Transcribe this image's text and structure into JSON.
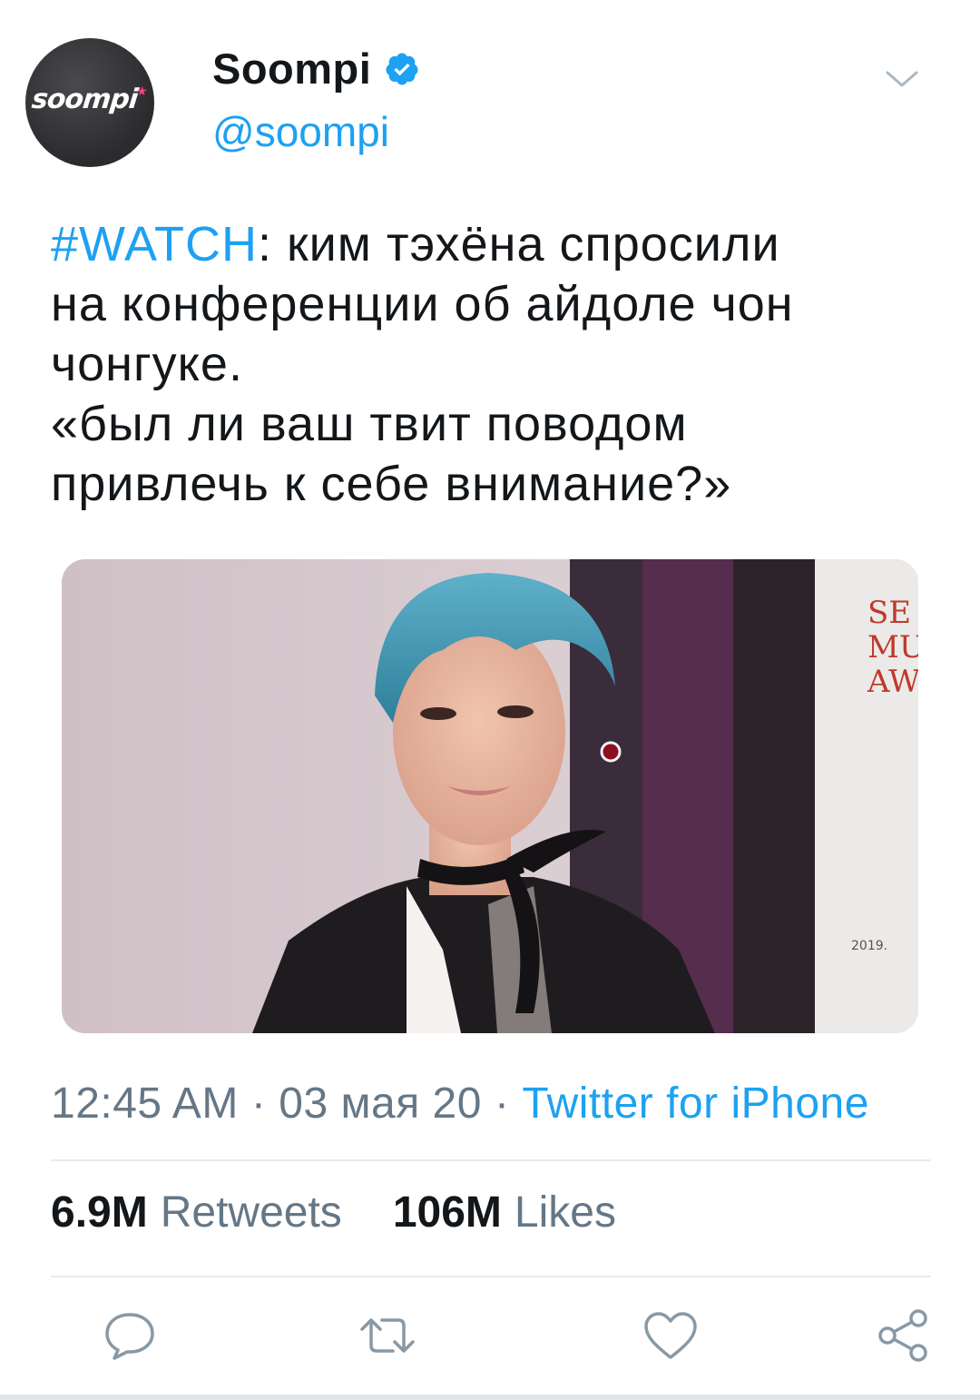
{
  "author": {
    "display_name": "Soompi",
    "handle": "@soompi",
    "avatar_logo_text": "soompi",
    "verified": true
  },
  "tweet": {
    "hashtag": "#WATCH",
    "line1_rest": ": ким тэхёна спросили",
    "line2": "на конференции об айдоле чон",
    "line3": "чонгуке.",
    "line4": "«был ли ваш твит поводом",
    "line5": "привлечь к себе внимание?»"
  },
  "meta": {
    "time": "12:45 AM",
    "separator": "·",
    "date": "03 мая 20",
    "source": "Twitter for iPhone"
  },
  "stats": {
    "retweets_count": "6.9M",
    "retweets_label": "Retweets",
    "likes_count": "106M",
    "likes_label": "Likes"
  },
  "media": {
    "background_sign_text": "SE MU AW",
    "background_sign_small": "2019."
  },
  "icons": {
    "reply": "reply-icon",
    "retweet": "retweet-icon",
    "like": "heart-icon",
    "share": "share-icon",
    "menu": "chevron-down-icon",
    "verified": "verified-badge-icon"
  },
  "colors": {
    "accent": "#1da1f2",
    "text": "#14171a",
    "muted": "#657786",
    "divider": "#e6ecf0"
  }
}
